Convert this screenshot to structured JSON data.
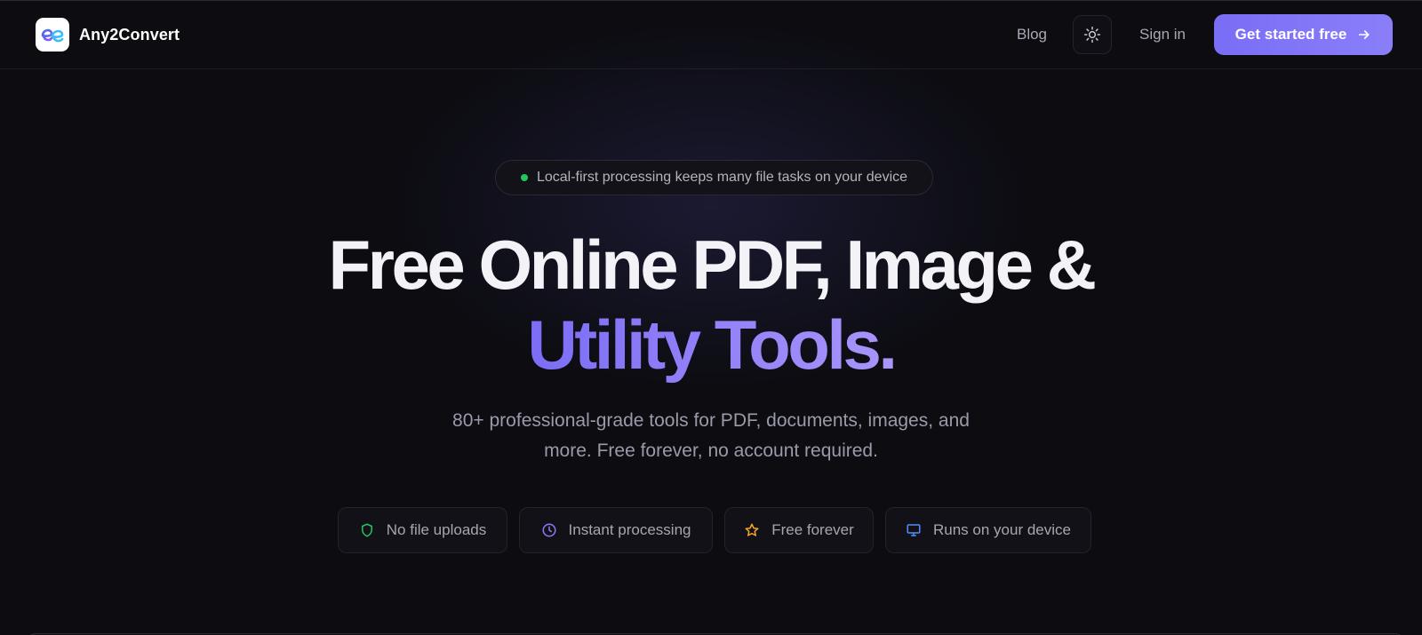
{
  "header": {
    "brand_name": "Any2Convert",
    "nav": {
      "blog": "Blog",
      "sign_in": "Sign in",
      "cta_label": "Get started free"
    },
    "icons": {
      "logo": "any2convert-logo",
      "theme_toggle": "sun-icon",
      "cta_arrow": "arrow-right-icon"
    }
  },
  "hero": {
    "badge": "Local-first processing keeps many file tasks on your device",
    "badge_dot_color": "#22c55e",
    "headline_line1": "Free Online PDF, Image &",
    "headline_line2": "Utility Tools.",
    "subtitle_line1": "80+ professional-grade tools for PDF, documents, images, and",
    "subtitle_line2": "more. Free forever, no account required."
  },
  "features": [
    {
      "label": "No file uploads",
      "icon": "shield-icon",
      "color": "#22c55e"
    },
    {
      "label": "Instant processing",
      "icon": "clock-icon",
      "color": "#8b7cf6"
    },
    {
      "label": "Free forever",
      "icon": "star-icon",
      "color": "#f5a524"
    },
    {
      "label": "Runs on your device",
      "icon": "monitor-icon",
      "color": "#4f8ff7"
    }
  ],
  "colors": {
    "background": "#0c0c11",
    "accent": "#7b6df5",
    "accent_light": "#a995fb"
  }
}
